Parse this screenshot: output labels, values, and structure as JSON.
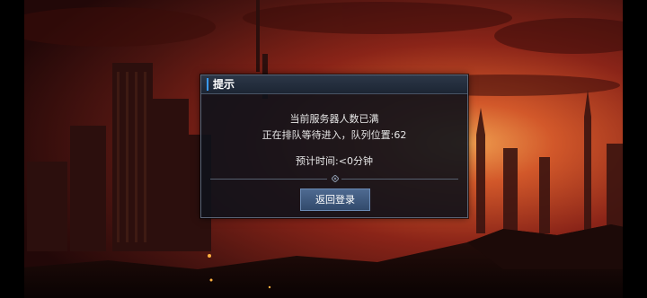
{
  "dialog": {
    "title": "提示",
    "message_line_1": "当前服务器人数已满",
    "message_line_2": "正在排队等待进入，队列位置:62",
    "estimated_time": "预计时间:<0分钟",
    "button_label": "返回登录"
  },
  "colors": {
    "accent": "#3a9bff",
    "button": "#3e5a80",
    "dialog_bg": "#0e121a",
    "sky_glow": "#c8451e"
  }
}
